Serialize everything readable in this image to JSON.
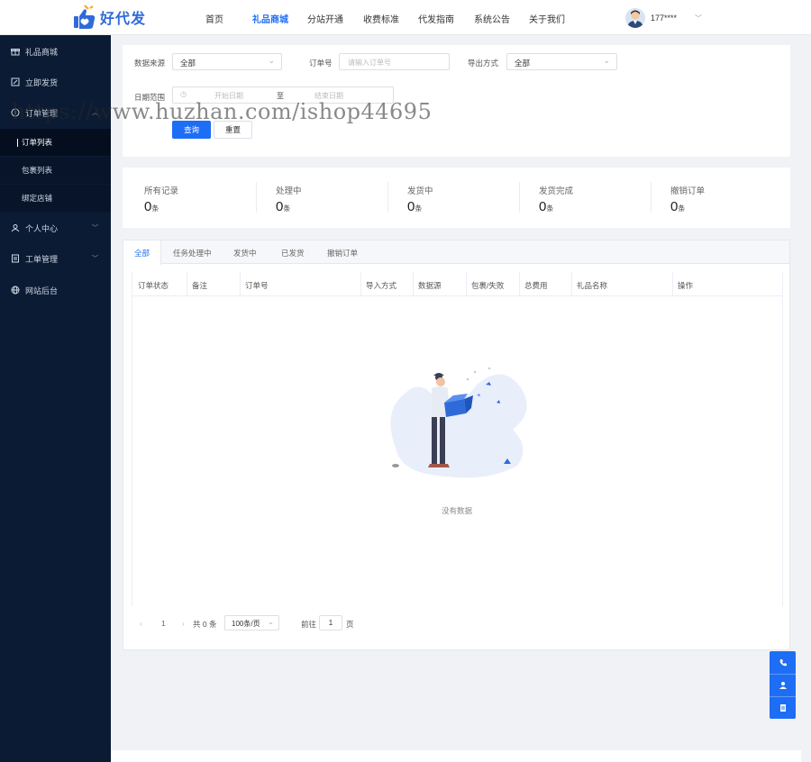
{
  "brand": {
    "name": "好代发"
  },
  "nav": {
    "items": [
      "首页",
      "礼品商城",
      "分站开通",
      "收费标准",
      "代发指南",
      "系统公告",
      "关于我们"
    ],
    "active_index": 1
  },
  "user": {
    "name": "177****"
  },
  "sidebar": {
    "items": [
      {
        "label": "礼品商城",
        "icon": "gift-icon"
      },
      {
        "label": "立即发货",
        "icon": "edit-icon"
      },
      {
        "label": "订单管理",
        "icon": "order-icon"
      },
      {
        "label": "个人中心",
        "icon": "user-icon"
      },
      {
        "label": "工单管理",
        "icon": "ticket-icon"
      },
      {
        "label": "网站后台",
        "icon": "globe-icon"
      }
    ],
    "sub_items": [
      "订单列表",
      "包裹列表",
      "绑定店铺"
    ],
    "active_sub": 0
  },
  "filters": {
    "source_label": "数据来源",
    "source_value": "全部",
    "order_no_label": "订单号",
    "order_no_placeholder": "请输入订单号",
    "export_label": "导出方式",
    "export_value": "全部",
    "date_label": "日期范围",
    "date_start_placeholder": "开始日期",
    "date_sep": "至",
    "date_end_placeholder": "结束日期",
    "query_button": "查询",
    "reset_button": "重置"
  },
  "stats": [
    {
      "label": "所有记录",
      "value": "0",
      "unit": "条"
    },
    {
      "label": "处理中",
      "value": "0",
      "unit": "条"
    },
    {
      "label": "发货中",
      "value": "0",
      "unit": "条"
    },
    {
      "label": "发货完成",
      "value": "0",
      "unit": "条"
    },
    {
      "label": "撤销订单",
      "value": "0",
      "unit": "条"
    }
  ],
  "tabs": [
    "全部",
    "任务处理中",
    "发货中",
    "已发货",
    "撤销订单"
  ],
  "active_tab": 0,
  "table": {
    "columns": [
      "订单状态",
      "备注",
      "订单号",
      "导入方式",
      "数据源",
      "包裹/失败",
      "总费用",
      "礼品名称",
      "操作"
    ],
    "empty_text": "没有数据"
  },
  "pagination": {
    "prev": "‹",
    "current_page": "1",
    "next": "›",
    "total": "共 0 条",
    "page_size": "100条/页",
    "goto_label": "前往",
    "goto_value": "1",
    "page_suffix": "页"
  },
  "float_buttons": [
    "phone-icon",
    "contact-icon",
    "doc-icon"
  ],
  "watermark": "https://www.huzhan.com/ishop44695",
  "colors": {
    "primary": "#1d6ef5",
    "sidebar": "#0b1b34",
    "background": "#f0f2f5"
  }
}
